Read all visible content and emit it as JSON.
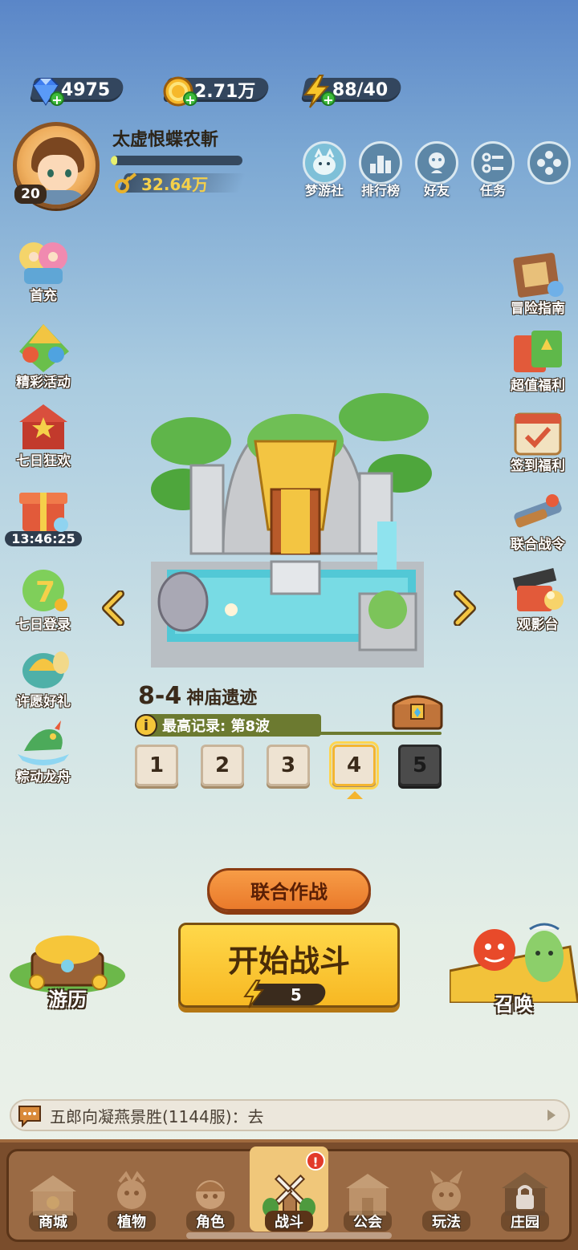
{
  "currencies": {
    "diamonds": "4975",
    "gold": "2.71万",
    "energy": "88/40"
  },
  "player": {
    "name": "太虚恨蝶农斬",
    "level": "20",
    "power": "32.64万",
    "xp_progress": 0.05
  },
  "top_nav": [
    {
      "label": "梦游社",
      "icon": "mascot-icon"
    },
    {
      "label": "排行榜",
      "icon": "ranking-icon"
    },
    {
      "label": "好友",
      "icon": "friends-icon"
    },
    {
      "label": "任务",
      "icon": "tasks-icon"
    },
    {
      "label": "",
      "icon": "more-icon"
    }
  ],
  "left_side": [
    {
      "label": "首充",
      "icon": "first-recharge-icon"
    },
    {
      "label": "精彩活动",
      "icon": "activities-icon"
    },
    {
      "label": "七日狂欢",
      "icon": "seven-day-carnival-icon"
    },
    {
      "label": "13:46:25",
      "icon": "gift-box-icon"
    },
    {
      "label": "七日登录",
      "icon": "seven-day-login-icon"
    },
    {
      "label": "许愿好礼",
      "icon": "wish-gift-icon"
    },
    {
      "label": "粽动龙舟",
      "icon": "dragon-boat-icon"
    }
  ],
  "right_side": [
    {
      "label": "冒险指南",
      "icon": "adventure-guide-icon"
    },
    {
      "label": "超值福利",
      "icon": "value-welfare-icon"
    },
    {
      "label": "签到福利",
      "icon": "sign-in-icon"
    },
    {
      "label": "联合战令",
      "icon": "battle-pass-icon"
    },
    {
      "label": "观影台",
      "icon": "cinema-icon"
    }
  ],
  "stage": {
    "number": "8-4",
    "name": "神庙遗迹",
    "record": "最高记录: 第8波",
    "waves": [
      "1",
      "2",
      "3",
      "4",
      "5"
    ],
    "selected_wave": "4",
    "locked_wave": "5"
  },
  "actions": {
    "coop_label": "联合作战",
    "start_label": "开始战斗",
    "energy_cost": "5",
    "travel_label": "游历",
    "summon_label": "召唤"
  },
  "chat": {
    "message": "五郎向凝燕景胜(1144服)：去"
  },
  "bottom_nav": [
    {
      "label": "商城",
      "icon": "shop-icon"
    },
    {
      "label": "植物",
      "icon": "plants-icon"
    },
    {
      "label": "角色",
      "icon": "character-icon"
    },
    {
      "label": "战斗",
      "icon": "windmill-icon",
      "active": true,
      "badge": "!"
    },
    {
      "label": "公会",
      "icon": "guild-icon"
    },
    {
      "label": "玩法",
      "icon": "gameplay-icon"
    },
    {
      "label": "庄园",
      "icon": "manor-locked-icon"
    }
  ],
  "colors": {
    "accent_yellow": "#f7b823",
    "accent_orange": "#ea7a2b",
    "nav_brown": "#7a4d2c"
  }
}
